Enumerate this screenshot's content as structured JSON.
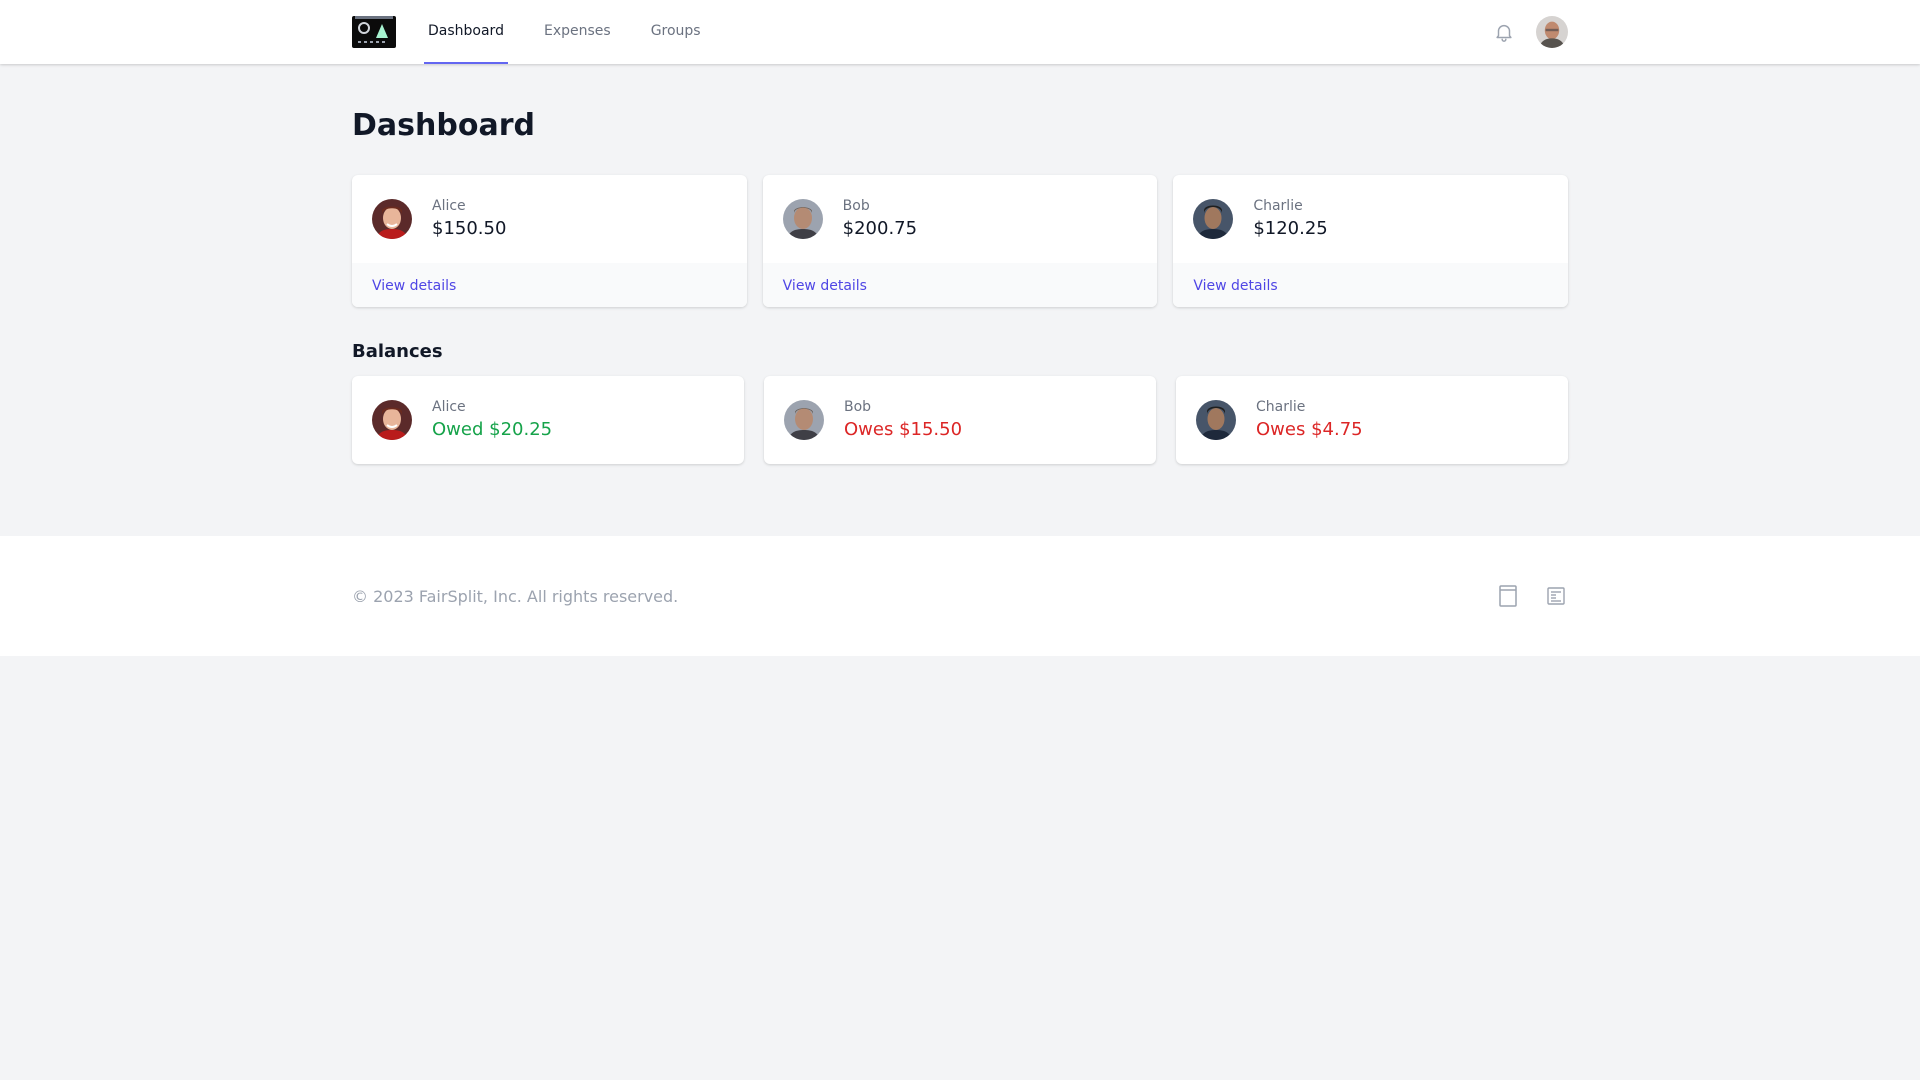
{
  "nav": {
    "tabs": [
      {
        "label": "Dashboard",
        "active": true
      },
      {
        "label": "Expenses",
        "active": false
      },
      {
        "label": "Groups",
        "active": false
      }
    ]
  },
  "page": {
    "title": "Dashboard"
  },
  "summary": [
    {
      "name": "Alice",
      "amount": "$150.50",
      "link": "View details"
    },
    {
      "name": "Bob",
      "amount": "$200.75",
      "link": "View details"
    },
    {
      "name": "Charlie",
      "amount": "$120.25",
      "link": "View details"
    }
  ],
  "balances": {
    "title": "Balances",
    "items": [
      {
        "name": "Alice",
        "status": "Owed $20.25",
        "tone": "owed"
      },
      {
        "name": "Bob",
        "status": "Owes $15.50",
        "tone": "owes"
      },
      {
        "name": "Charlie",
        "status": "Owes $4.75",
        "tone": "owes"
      }
    ]
  },
  "footer": {
    "copyright": "© 2023 FairSplit, Inc. All rights reserved."
  },
  "colors": {
    "accent": "#6366f1",
    "link": "#4f46e5",
    "owed": "#16a34a",
    "owes": "#dc2626",
    "background": "#f3f4f6"
  },
  "icons": [
    "bell-icon",
    "user-avatar",
    "footer-document-icon",
    "footer-newspaper-icon"
  ]
}
